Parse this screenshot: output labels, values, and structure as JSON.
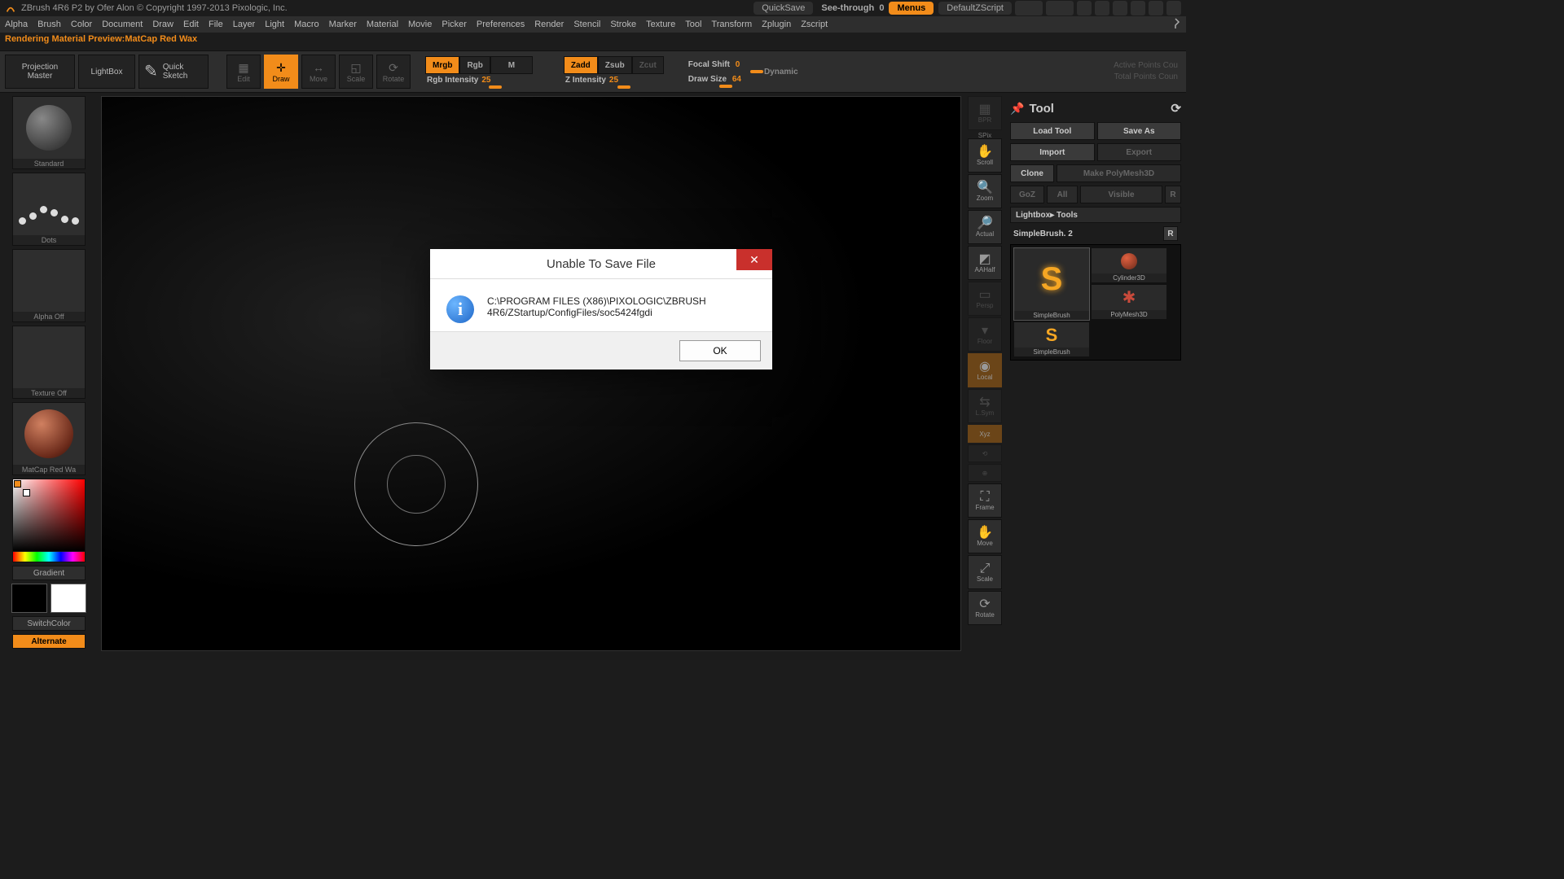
{
  "titlebar": {
    "app_title": "ZBrush 4R6 P2 by Ofer Alon © Copyright 1997-2013 Pixologic, Inc.",
    "quicksave": "QuickSave",
    "seethrough_label": "See-through",
    "seethrough_value": "0",
    "menus": "Menus",
    "default_zscript": "DefaultZScript"
  },
  "menubar": {
    "items": [
      "Alpha",
      "Brush",
      "Color",
      "Document",
      "Draw",
      "Edit",
      "File",
      "Layer",
      "Light",
      "Macro",
      "Marker",
      "Material",
      "Movie",
      "Picker",
      "Preferences",
      "Render",
      "Stencil",
      "Stroke",
      "Texture",
      "Tool",
      "Transform",
      "Zplugin",
      "Zscript"
    ]
  },
  "status": {
    "text": "Rendering Material Preview:MatCap Red Wax"
  },
  "toolbar": {
    "projection_master": "Projection Master",
    "lightbox": "LightBox",
    "quick_sketch": "Quick Sketch",
    "modes": {
      "edit": "Edit",
      "draw": "Draw",
      "move": "Move",
      "scale": "Scale",
      "rotate": "Rotate"
    },
    "rgb": {
      "mrgb": "Mrgb",
      "rgb": "Rgb",
      "m": "M"
    },
    "rgb_intensity_label": "Rgb Intensity",
    "rgb_intensity_value": "25",
    "z": {
      "zadd": "Zadd",
      "zsub": "Zsub",
      "zcut": "Zcut"
    },
    "z_intensity_label": "Z Intensity",
    "z_intensity_value": "25",
    "focal_shift_label": "Focal Shift",
    "focal_shift_value": "0",
    "draw_size_label": "Draw Size",
    "draw_size_value": "64",
    "dynamic": "Dynamic",
    "active_points": "Active Points Cou",
    "total_points": "Total Points Coun"
  },
  "left": {
    "brush": "Standard",
    "stroke": "Dots",
    "alpha": "Alpha Off",
    "texture": "Texture Off",
    "material": "MatCap Red Wa",
    "gradient": "Gradient",
    "switch": "SwitchColor",
    "alternate": "Alternate"
  },
  "nav": {
    "bpr": "BPR",
    "spix": "SPix",
    "scroll": "Scroll",
    "zoom": "Zoom",
    "actual": "Actual",
    "aahalf": "AAHalf",
    "persp": "Persp",
    "floor": "Floor",
    "local": "Local",
    "lsym": "L.Sym",
    "xyz": "Xyz",
    "frame": "Frame",
    "move": "Move",
    "scale": "Scale",
    "rotate": "Rotate"
  },
  "tool_panel": {
    "title": "Tool",
    "load": "Load Tool",
    "saveas": "Save As",
    "import": "Import",
    "export": "Export",
    "clone": "Clone",
    "make": "Make PolyMesh3D",
    "goz": "GoZ",
    "all": "All",
    "visible": "Visible",
    "r": "R",
    "breadcrumb": "Lightbox▸ Tools",
    "subtool_name": "SimpleBrush. 2",
    "subtool_r": "R",
    "thumbs": {
      "simplebrush": "SimpleBrush",
      "cylinder": "Cylinder3D",
      "polymesh": "PolyMesh3D",
      "simplebrush2": "SimpleBrush"
    }
  },
  "dialog": {
    "title": "Unable To Save File",
    "line1": "C:\\PROGRAM FILES (X86)\\PIXOLOGIC\\ZBRUSH",
    "line2": "4R6/ZStartup/ConfigFiles/soc5424fgdi",
    "ok": "OK"
  }
}
